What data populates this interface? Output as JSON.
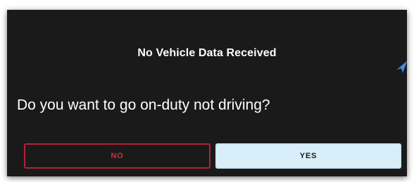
{
  "dialog": {
    "title": "No Vehicle Data Received",
    "question": "Do you want to go on-duty not driving?",
    "buttons": {
      "no_label": "NO",
      "yes_label": "YES"
    }
  },
  "colors": {
    "dialog_background": "#1a1a1a",
    "no_button_accent": "#d42a46",
    "yes_button_background": "#d8eef9",
    "pointer_accent": "#4a90d9"
  },
  "icons": {
    "pointer": "arrow-pointer-icon"
  }
}
